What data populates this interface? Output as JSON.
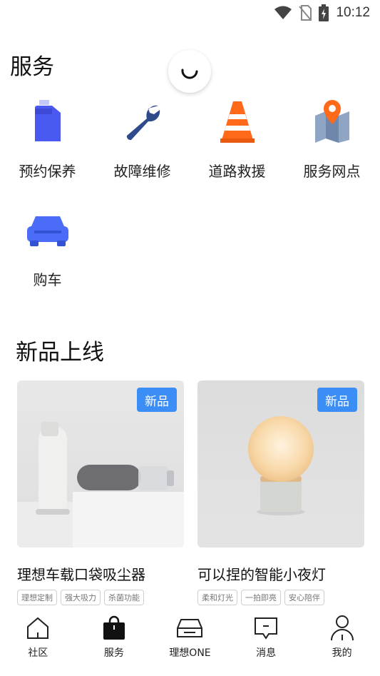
{
  "status_bar": {
    "time": "10:12"
  },
  "page_title": "服务",
  "services": [
    {
      "label": "预约保养",
      "icon": "oil-can-icon"
    },
    {
      "label": "故障维修",
      "icon": "wrench-icon"
    },
    {
      "label": "道路救援",
      "icon": "traffic-cone-icon"
    },
    {
      "label": "服务网点",
      "icon": "map-pin-icon"
    },
    {
      "label": "购车",
      "icon": "car-icon"
    }
  ],
  "new_products": {
    "title": "新品上线",
    "items": [
      {
        "badge": "新品",
        "name": "理想车载口袋吸尘器",
        "tags": [
          "理想定制",
          "强大吸力",
          "杀菌功能"
        ]
      },
      {
        "badge": "新品",
        "name": "可以捏的智能小夜灯",
        "tags": [
          "柔和灯光",
          "一拍即亮",
          "安心陪伴"
        ]
      }
    ]
  },
  "tabbar": [
    {
      "label": "社区",
      "icon": "home-icon"
    },
    {
      "label": "服务",
      "icon": "bag-icon",
      "active": true
    },
    {
      "label": "理想ONE",
      "icon": "car-outline-icon"
    },
    {
      "label": "消息",
      "icon": "message-icon"
    },
    {
      "label": "我的",
      "icon": "person-icon"
    }
  ],
  "colors": {
    "accent_blue": "#3a8ef6",
    "service_blue": "#4a6cf7",
    "cone_orange": "#ff6a1a",
    "wrench_navy": "#2f4a8a"
  }
}
